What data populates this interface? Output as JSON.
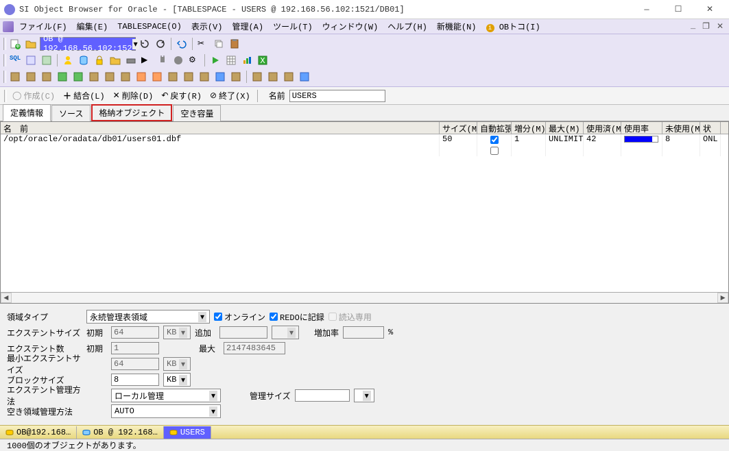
{
  "window_title": "SI Object Browser for Oracle - [TABLESPACE - USERS @ 192.168.56.102:1521/DB01]",
  "menu": {
    "file": "ファイル(F)",
    "edit": "編集(E)",
    "tablespace": "TABLESPACE(O)",
    "view": "表示(V)",
    "admin": "管理(A)",
    "tool": "ツール(T)",
    "window": "ウィンドウ(W)",
    "help": "ヘルプ(H)",
    "new": "新機能(N)",
    "obtoko": "OBトコ(I)"
  },
  "conn_label": "OB @ 192.168.56.102:152",
  "actions": {
    "create": "作成(C)",
    "merge": "結合(L)",
    "delete": "削除(D)",
    "revert": "戻す(R)",
    "exit": "終了(X)",
    "name_lbl": "名前",
    "name_val": "USERS"
  },
  "tabs": {
    "t0": "定義情報",
    "t1": "ソース",
    "t2": "格納オブジェクト",
    "t3": "空き容量"
  },
  "grid": {
    "headers": {
      "name": "名　前",
      "size": "サイズ(M)",
      "autoext": "自動拡張",
      "inc": "増分(M)",
      "max": "最大(M)",
      "used": "使用済(M)",
      "usage": "使用率",
      "free": "未使用(M)",
      "stat": "状"
    },
    "row0": {
      "name": "/opt/oracle/oradata/db01/users01.dbf",
      "size": "50",
      "autoext": true,
      "inc": "1",
      "max": "UNLIMITED",
      "used": "42",
      "free": "8",
      "stat": "ONL",
      "usage_pct": 84
    }
  },
  "form": {
    "region_type_lbl": "領域タイプ",
    "region_type_val": "永続管理表領域",
    "online_lbl": "オンライン",
    "redo_lbl": "REDOに記録",
    "readonly_lbl": "読込専用",
    "extent_size_lbl": "エクステントサイズ",
    "initial_lbl": "初期",
    "extent_initial": "64",
    "kb": "KB",
    "add_lbl": "追加",
    "add_val": "",
    "inc_rate_lbl": "増加率",
    "inc_rate_val": "",
    "pct": "%",
    "extent_count_lbl": "エクステント数",
    "extent_count_initial": "1",
    "max_lbl": "最大",
    "extent_count_max": "2147483645",
    "min_extent_lbl": "最小エクステントサイズ",
    "min_extent_val": "64",
    "block_size_lbl": "ブロックサイズ",
    "block_size_val": "8",
    "extent_mgmt_lbl": "エクステント管理方法",
    "extent_mgmt_val": "ローカル管理",
    "mgmt_size_lbl": "管理サイズ",
    "mgmt_size_val": "",
    "free_mgmt_lbl": "空き領域管理方法",
    "free_mgmt_val": "AUTO"
  },
  "bottom_tabs": {
    "t0": "OB@192.168…",
    "t1": "OB @ 192.168…",
    "t2": "USERS"
  },
  "status": "1000個のオブジェクトがあります。"
}
